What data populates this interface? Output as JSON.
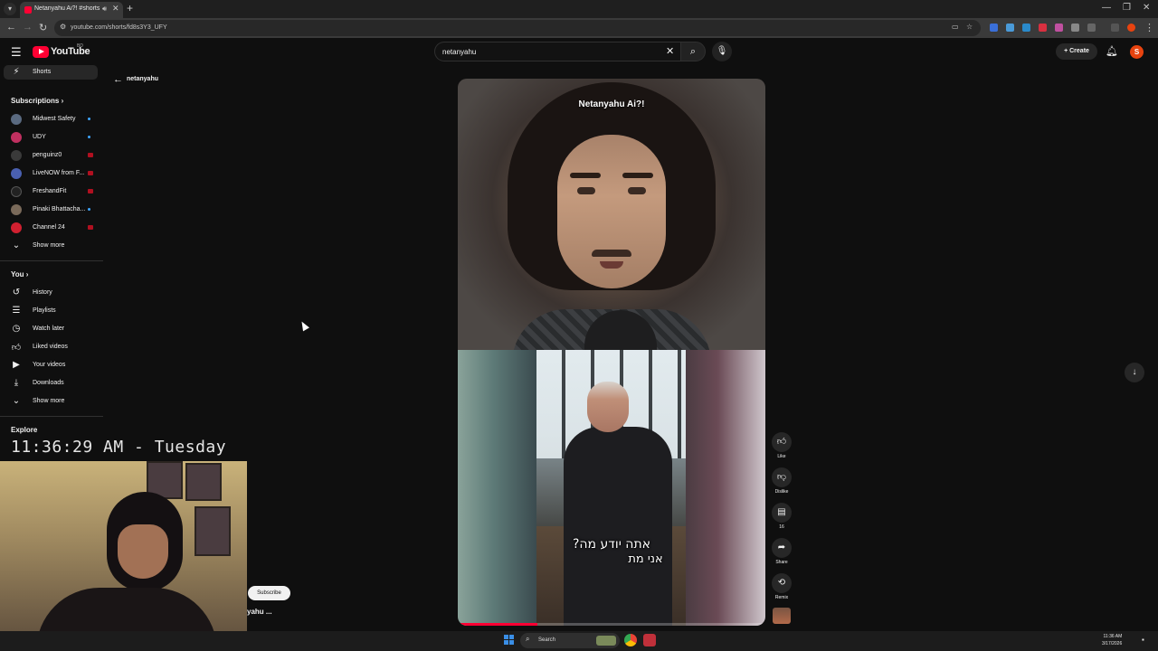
{
  "browser": {
    "tab_title": "Netanyahu Ai?! #shorts #n",
    "url": "youtube.com/shorts/fd8s3Y3_UFY"
  },
  "masthead": {
    "logo_text": "YouTube",
    "country_code": "BD",
    "search_value": "netanyahu",
    "create_label": "Create",
    "avatar_letter": "S"
  },
  "sidebar": {
    "shorts_label": "Shorts",
    "subscriptions_heading": "Subscriptions",
    "subscriptions": [
      {
        "name": "Midwest Safety",
        "indicator": "new"
      },
      {
        "name": "UDY",
        "indicator": "new"
      },
      {
        "name": "penguinz0",
        "indicator": "live"
      },
      {
        "name": "LiveNOW from F...",
        "indicator": "live"
      },
      {
        "name": "FreshandFit",
        "indicator": "live"
      },
      {
        "name": "Pinaki Bhattacha...",
        "indicator": "new"
      },
      {
        "name": "Channel 24",
        "indicator": "live"
      }
    ],
    "show_more_1": "Show more",
    "you_heading": "You",
    "you_items": [
      "History",
      "Playlists",
      "Watch later",
      "Liked videos",
      "Your videos",
      "Downloads"
    ],
    "show_more_2": "Show more",
    "explore_heading": "Explore"
  },
  "back": {
    "label": "netanyahu"
  },
  "video": {
    "title_overlay": "Netanyahu Ai?!",
    "subtitle_line1": "אתה יודע מה?",
    "subtitle_line2": "אני מת",
    "progress_fraction": 0.26
  },
  "actions": {
    "like_label": "Like",
    "dislike_label": "Dislike",
    "comments_count": "16",
    "share_label": "Share",
    "remix_label": "Remix"
  },
  "overlay": {
    "clock_text": "11:36:29 AM - Tuesday",
    "subscribe_label": "Subscribe",
    "channel_name_partial": "yahu ..."
  },
  "taskbar": {
    "search_label": "Search",
    "time": "11:36 AM",
    "date": "3/17/2026"
  },
  "colors": {
    "brand_red": "#ff0033",
    "background": "#0f0f0f",
    "accent_blue": "#3ea6ff"
  }
}
